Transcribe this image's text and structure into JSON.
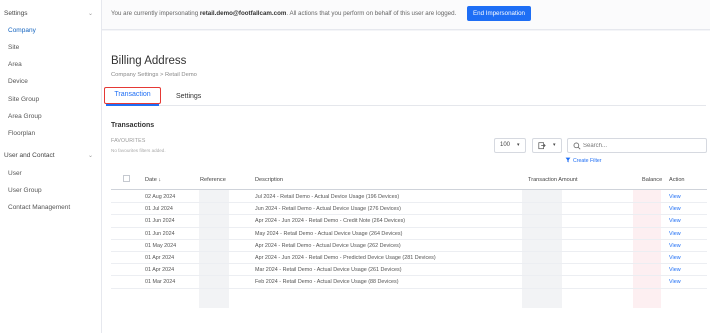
{
  "sidebar": {
    "settings_label": "Settings",
    "settings_items": [
      "Company",
      "Site",
      "Area",
      "Device",
      "Site Group",
      "Area Group",
      "Floorplan"
    ],
    "user_label": "User and Contact",
    "user_items": [
      "User",
      "User Group",
      "Contact Management"
    ],
    "chevron": "chevron-down-icon"
  },
  "impersonation": {
    "prefix": "You are currently impersonating ",
    "email": "retail.demo@footfallcam.com",
    "suffix": ". All actions that you perform on behalf of this user are logged.",
    "button": "End Impersonation"
  },
  "page": {
    "title": "Billing Address",
    "breadcrumb": "Company Settings > Retail Demo"
  },
  "tabs": [
    "Transaction",
    "Settings"
  ],
  "transactions": {
    "title": "Transactions",
    "favourites_label": "FAVOURITES",
    "favourites_note": "No favourites filters added.",
    "page_size": "100",
    "search_placeholder": "Search...",
    "create_filter": "Create Filter",
    "headers": {
      "date": "Date ↓",
      "reference": "Reference",
      "description": "Description",
      "amount": "Transaction Amount",
      "balance": "Balance",
      "action": "Action"
    },
    "rows": [
      {
        "date": "02 Aug 2024",
        "description": "Jul 2024 - Retail Demo - Actual Device Usage (196 Devices)",
        "action": "View"
      },
      {
        "date": "01 Jul 2024",
        "description": "Jun 2024 - Retail Demo - Actual Device Usage (276 Devices)",
        "action": "View"
      },
      {
        "date": "01 Jun 2024",
        "description": "Apr 2024 - Jun 2024 - Retail Demo - Credit Note (264 Devices)",
        "action": "View"
      },
      {
        "date": "01 Jun 2024",
        "description": "May 2024 - Retail Demo - Actual Device Usage (264 Devices)",
        "action": "View"
      },
      {
        "date": "01 May 2024",
        "description": "Apr 2024 - Retail Demo - Actual Device Usage (262 Devices)",
        "action": "View"
      },
      {
        "date": "01 Apr 2024",
        "description": "Apr 2024 - Jun 2024 - Retail Demo - Predicted Device Usage (281 Devices)",
        "action": "View"
      },
      {
        "date": "01 Apr 2024",
        "description": "Mar 2024 - Retail Demo - Actual Device Usage (261 Devices)",
        "action": "View"
      },
      {
        "date": "01 Mar 2024",
        "description": "Feb 2024 - Retail Demo - Actual Device Usage (88 Devices)",
        "action": "View"
      }
    ]
  },
  "colors": {
    "accent": "#1e6ef5",
    "highlight": "#e53935"
  }
}
